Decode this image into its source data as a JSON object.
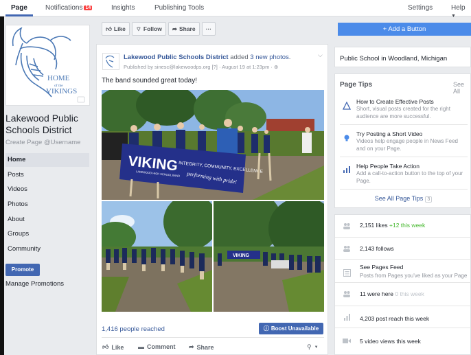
{
  "topnav": {
    "tabs": [
      {
        "label": "Page"
      },
      {
        "label": "Notifications",
        "badge": "14"
      },
      {
        "label": "Insights"
      },
      {
        "label": "Publishing Tools"
      }
    ],
    "settings_label": "Settings",
    "help_label": "Help"
  },
  "profile": {
    "logo_line1": "HOME",
    "logo_line2": "of the",
    "logo_line3": "VIKINGS",
    "name": "Lakewood Public Schools District",
    "username_prompt": "Create Page @Username"
  },
  "leftnav": {
    "items": [
      {
        "label": "Home"
      },
      {
        "label": "Posts"
      },
      {
        "label": "Videos"
      },
      {
        "label": "Photos"
      },
      {
        "label": "About"
      },
      {
        "label": "Groups"
      },
      {
        "label": "Community"
      }
    ],
    "promote_label": "Promote",
    "manage_promotions_label": "Manage Promotions"
  },
  "actionbar": {
    "like_label": "Like",
    "follow_label": "Follow",
    "share_label": "Share",
    "more_label": "···"
  },
  "post": {
    "author": "Lakewood Public Schools District",
    "action": "added",
    "photos_link": "3 new photos",
    "published_by": "Published by sinesc@lakewoodps.org [?] · August 19 at 1:23pm · ",
    "text": "The band sounded great today!",
    "banner_main": "VIKING",
    "banner_sub": "LAKEWOOD HIGH SCHOOL BAND",
    "banner_motto": "INTEGRITY, COMMUNITY, EXCELLENCE",
    "banner_motto2": "performing with pride!",
    "banner2": "VIKING",
    "reached": "1,416 people reached",
    "boost_label": "Boost Unavailable",
    "like_label": "Like",
    "comment_label": "Comment",
    "share_label": "Share"
  },
  "right": {
    "add_button_label": "+ Add a Button",
    "about_text": "Public School in Woodland, Michigan",
    "tips_title": "Page Tips",
    "tips_see_all": "See All",
    "tips": [
      {
        "icon": "pyramid-icon",
        "title": "How to Create Effective Posts",
        "desc": "Short, visual posts created for the right audience are more successful."
      },
      {
        "icon": "lightbulb-icon",
        "title": "Try Posting a Short Video",
        "desc": "Videos help engage people in News Feed and on your Page."
      },
      {
        "icon": "bar-chart-icon",
        "title": "Help People Take Action",
        "desc": "Add a call-to-action button to the top of your Page."
      }
    ],
    "see_all_tips_label": "See All Page Tips",
    "see_all_tips_count": "3",
    "stats": [
      {
        "icon": "people-icon",
        "text": "2,151 likes",
        "extra": "+12 this week"
      },
      {
        "icon": "people-icon",
        "text": "2,143 follows"
      },
      {
        "icon": "feed-icon",
        "text": "See Pages Feed",
        "sub": "Posts from Pages you've liked as your Page"
      },
      {
        "icon": "people-icon",
        "text": "11 were here",
        "extra": "0 this week"
      },
      {
        "icon": "bar-chart-icon",
        "text": "4,203 post reach this week"
      },
      {
        "icon": "video-icon",
        "text": "5 video views this week"
      }
    ]
  },
  "colors": {
    "brand_blue": "#4267b2",
    "link_blue": "#365899",
    "add_button_blue": "#4b8be9",
    "background": "#e9ebee",
    "positive_green": "#42b72a"
  }
}
